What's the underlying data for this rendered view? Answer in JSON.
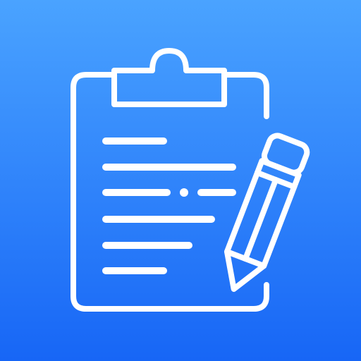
{
  "app_icon": {
    "icon_name": "clipboard-with-pencil-icon",
    "background_top_color": "#4aa3ff",
    "background_bottom_color": "#1766f6",
    "foreground_color": "#ffffff"
  }
}
